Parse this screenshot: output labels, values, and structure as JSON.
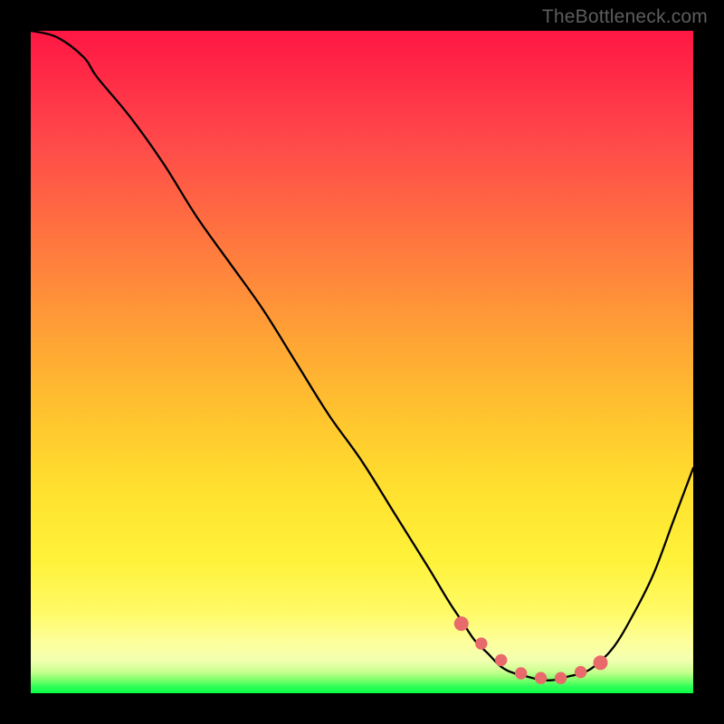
{
  "watermark": "TheBottleneck.com",
  "colors": {
    "frame": "#000000",
    "curve_stroke": "#000000",
    "dot_fill": "#e86a6a",
    "gradient_stops": [
      {
        "pos": 0,
        "hex": "#ff1744"
      },
      {
        "pos": 0.06,
        "hex": "#ff2846"
      },
      {
        "pos": 0.17,
        "hex": "#ff4a4a"
      },
      {
        "pos": 0.33,
        "hex": "#ff7a3e"
      },
      {
        "pos": 0.48,
        "hex": "#ffa834"
      },
      {
        "pos": 0.6,
        "hex": "#ffc92e"
      },
      {
        "pos": 0.7,
        "hex": "#ffe22f"
      },
      {
        "pos": 0.8,
        "hex": "#fff23a"
      },
      {
        "pos": 0.88,
        "hex": "#fffb68"
      },
      {
        "pos": 0.925,
        "hex": "#fcff9e"
      },
      {
        "pos": 0.95,
        "hex": "#f3ffb0"
      },
      {
        "pos": 0.968,
        "hex": "#c7ff8e"
      },
      {
        "pos": 0.98,
        "hex": "#7dff6b"
      },
      {
        "pos": 0.99,
        "hex": "#2fff58"
      },
      {
        "pos": 1.0,
        "hex": "#0aff46"
      }
    ]
  },
  "chart_data": {
    "type": "line",
    "title": "",
    "xlabel": "",
    "ylabel": "",
    "xlim": [
      0,
      100
    ],
    "ylim": [
      0,
      100
    ],
    "note": "Bottleneck curve: y=100 is worst (top/red), y=0 is best (bottom/green). Curve descends from top-left, reaches a flat minimum near x≈72–82, then rises toward the right edge.",
    "series": [
      {
        "name": "bottleneck-curve",
        "x": [
          0,
          4,
          8,
          10,
          15,
          20,
          25,
          30,
          35,
          40,
          45,
          50,
          55,
          60,
          63,
          65,
          67,
          69,
          71,
          73,
          75,
          77,
          79,
          81,
          83,
          85,
          88,
          91,
          94,
          97,
          100
        ],
        "y": [
          100,
          99,
          96,
          93,
          87,
          80,
          72,
          65,
          58,
          50,
          42,
          35,
          27,
          19,
          14,
          11,
          8,
          6,
          4,
          3,
          2.5,
          2,
          2,
          2.5,
          3,
          4,
          7,
          12,
          18,
          26,
          34
        ]
      }
    ],
    "highlight_dots": {
      "name": "optimal-range-markers",
      "x": [
        65,
        68,
        71,
        74,
        77,
        80,
        83,
        86
      ],
      "y": [
        10.5,
        7.5,
        5,
        3,
        2.3,
        2.3,
        3.2,
        4.6
      ]
    }
  }
}
